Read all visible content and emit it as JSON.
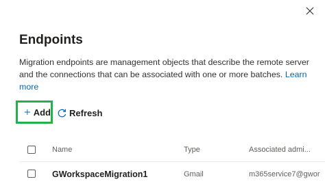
{
  "panel": {
    "title": "Endpoints",
    "description": "Migration endpoints are management objects that describe the remote server and the connections that can be associated with one or more batches.",
    "learn_more": "Learn more"
  },
  "toolbar": {
    "add_label": "Add",
    "refresh_label": "Refresh"
  },
  "table": {
    "columns": [
      "Name",
      "Type",
      "Associated admi..."
    ],
    "rows": [
      {
        "name": "GWorkspaceMigration1",
        "type": "Gmail",
        "admin": "m365service7@gwor"
      }
    ]
  },
  "colors": {
    "accent": "#0067b8",
    "highlight_box": "#22b14c"
  },
  "icons": {
    "close": "close-icon",
    "add": "plus-icon",
    "refresh": "refresh-icon"
  }
}
